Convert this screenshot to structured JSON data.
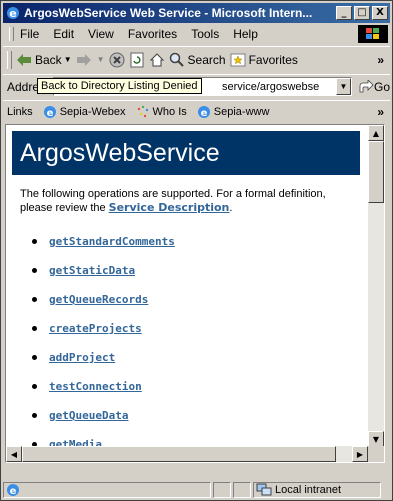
{
  "window": {
    "title": "ArgosWebService Web Service - Microsoft Intern...",
    "controls": {
      "minimize": "_",
      "maximize": "□",
      "close": "X"
    }
  },
  "menubar": {
    "items": [
      {
        "label": "File"
      },
      {
        "label": "Edit"
      },
      {
        "label": "View"
      },
      {
        "label": "Favorites"
      },
      {
        "label": "Tools"
      },
      {
        "label": "Help"
      }
    ]
  },
  "toolbar": {
    "back_label": "Back",
    "search_label": "Search",
    "favorites_label": "Favorites",
    "more": "»"
  },
  "addressbar": {
    "label": "Address",
    "value": "service/argoswebse",
    "tooltip": "Back to Directory Listing Denied",
    "go_label": "Go"
  },
  "linksbar": {
    "label": "Links",
    "items": [
      {
        "label": "Sepia-Webex"
      },
      {
        "label": "Who Is"
      },
      {
        "label": "Sepia-www"
      }
    ],
    "more": "»"
  },
  "page": {
    "heading": "ArgosWebService",
    "intro": "The following operations are supported. For a formal definition, please review the ",
    "service_link": "Service Description",
    "intro_end": ".",
    "operations": [
      "getStandardComments",
      "getStaticData",
      "getQueueRecords",
      "createProjects",
      "addProject",
      "testConnection",
      "getQueueData",
      "getMedia"
    ]
  },
  "statusbar": {
    "zone": "Local intranet"
  },
  "colors": {
    "heading_band": "#003366",
    "link": "#336699",
    "titlebar_start": "#0a246a",
    "titlebar_end": "#3a6ea5"
  }
}
